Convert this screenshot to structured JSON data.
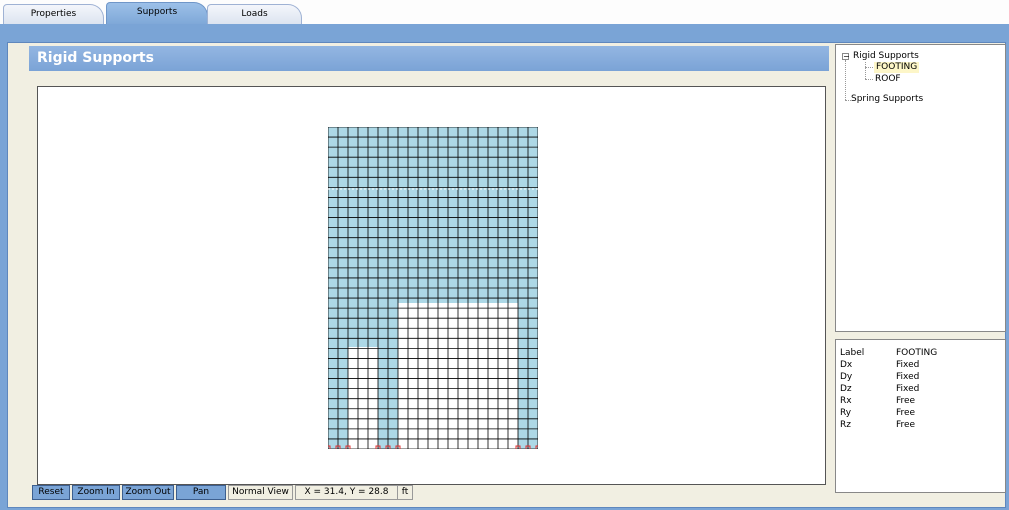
{
  "tabs": [
    {
      "label": "Properties",
      "active": false
    },
    {
      "label": "Supports",
      "active": true
    },
    {
      "label": "Loads",
      "active": false
    }
  ],
  "panel": {
    "title": "Rigid Supports"
  },
  "toolbar": {
    "reset_label": "Reset",
    "zoom_in_label": "Zoom In",
    "zoom_out_label": "Zoom Out",
    "pan_label": "Pan",
    "view_mode": "Normal View",
    "coordinates": "X = 31.4, Y = 28.8",
    "unit": "ft"
  },
  "tree": {
    "rigid_label": "Rigid Supports",
    "footing_label": "FOOTING",
    "roof_label": "ROOF",
    "spring_label": "Spring Supports"
  },
  "properties": [
    {
      "key": "Label",
      "value": "FOOTING"
    },
    {
      "key": "Dx",
      "value": "Fixed"
    },
    {
      "key": "Dy",
      "value": "Fixed"
    },
    {
      "key": "Dz",
      "value": "Fixed"
    },
    {
      "key": "Rx",
      "value": "Free"
    },
    {
      "key": "Ry",
      "value": "Free"
    },
    {
      "key": "Rz",
      "value": "Free"
    }
  ],
  "colors": {
    "frame_blue": "#7aa4d6",
    "mesh_fill": "#add8e6",
    "support_marker": "#e03030"
  }
}
